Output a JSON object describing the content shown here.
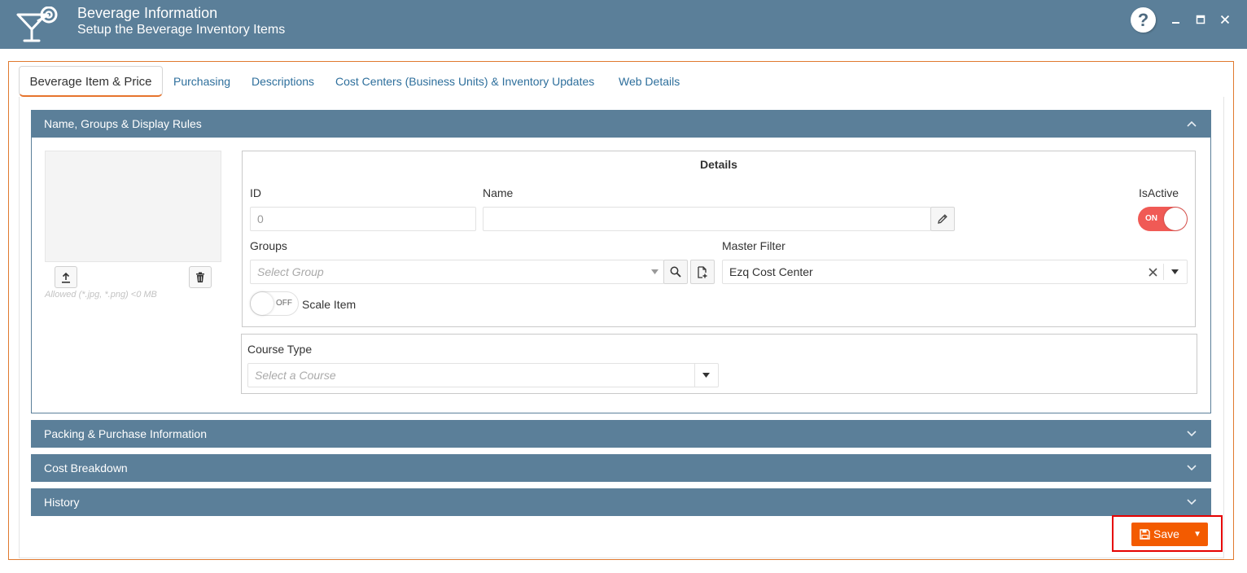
{
  "header": {
    "title": "Beverage Information",
    "subtitle": "Setup the Beverage Inventory Items",
    "help_label": "?",
    "minimize_icon": "minimize-icon",
    "maximize_icon": "maximize-icon",
    "close_icon": "close-icon",
    "logo_icon": "cocktail-glass-icon"
  },
  "tabs": [
    {
      "label": "Beverage Item & Price",
      "active": true
    },
    {
      "label": "Purchasing"
    },
    {
      "label": "Descriptions"
    },
    {
      "label": "Cost Centers (Business Units) & Inventory Updates"
    },
    {
      "label": "Web Details"
    }
  ],
  "sections": {
    "name_groups": "Name, Groups & Display Rules",
    "packing": "Packing & Purchase Information",
    "cost_breakdown": "Cost Breakdown",
    "history": "History"
  },
  "image": {
    "hint": "Allowed (*.jpg, *.png) <0 MB",
    "upload_icon": "upload-icon",
    "delete_icon": "trash-icon"
  },
  "details": {
    "title": "Details",
    "id_label": "ID",
    "id_value": "0",
    "name_label": "Name",
    "name_value": "",
    "isactive_label": "IsActive",
    "isactive_toggle": "ON",
    "groups_label": "Groups",
    "groups_placeholder": "Select Group",
    "master_filter_label": "Master Filter",
    "master_filter_value": "Ezq Cost Center",
    "scale_toggle": "OFF",
    "scale_label": "Scale Item"
  },
  "course": {
    "label": "Course Type",
    "placeholder": "Select a Course"
  },
  "footer": {
    "save_label": "Save"
  },
  "colors": {
    "header_bg": "#5b7f99",
    "accent": "#f35b00",
    "toggle_on": "#f05a55",
    "highlight": "#e60000"
  }
}
